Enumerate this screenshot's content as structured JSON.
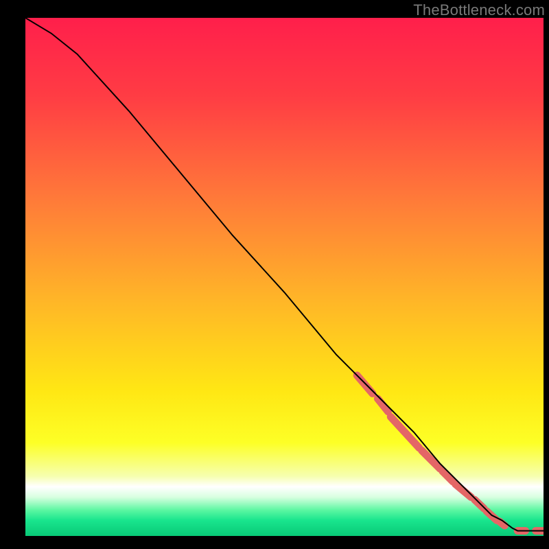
{
  "watermark": "TheBottleneck.com",
  "colors": {
    "black": "#000000",
    "watermark": "#797979",
    "curve": "#000000",
    "marker": "#e46666",
    "gradient_stops": [
      {
        "offset": 0.0,
        "color": "#ff1f4b"
      },
      {
        "offset": 0.15,
        "color": "#ff3c44"
      },
      {
        "offset": 0.35,
        "color": "#ff7a39"
      },
      {
        "offset": 0.55,
        "color": "#ffb727"
      },
      {
        "offset": 0.72,
        "color": "#ffe714"
      },
      {
        "offset": 0.82,
        "color": "#fdff26"
      },
      {
        "offset": 0.885,
        "color": "#f6ffb0"
      },
      {
        "offset": 0.905,
        "color": "#ffffff"
      },
      {
        "offset": 0.925,
        "color": "#d8ffe0"
      },
      {
        "offset": 0.95,
        "color": "#5cf7a2"
      },
      {
        "offset": 0.97,
        "color": "#19e58d"
      },
      {
        "offset": 1.0,
        "color": "#08c977"
      }
    ]
  },
  "chart_data": {
    "type": "line",
    "title": "",
    "xlabel": "",
    "ylabel": "",
    "xlim": [
      0,
      100
    ],
    "ylim": [
      0,
      100
    ],
    "series": [
      {
        "name": "bottleneck-curve",
        "x": [
          0,
          5,
          10,
          20,
          30,
          40,
          50,
          60,
          65,
          70,
          75,
          80,
          83,
          86,
          88,
          90,
          92,
          94,
          95,
          97,
          100
        ],
        "y": [
          100,
          97,
          93,
          82,
          70,
          58,
          47,
          35,
          30,
          25,
          20,
          14,
          11,
          8,
          6,
          4,
          3,
          1.5,
          1,
          1,
          1
        ]
      }
    ],
    "markers": {
      "name": "highlighted-segments",
      "segments": [
        {
          "x0": 64,
          "y0": 31,
          "x1": 67,
          "y1": 27.5
        },
        {
          "x0": 68,
          "y0": 26.5,
          "x1": 70,
          "y1": 24
        },
        {
          "x0": 70.5,
          "y0": 23,
          "x1": 76,
          "y1": 17
        },
        {
          "x0": 76.5,
          "y0": 16.5,
          "x1": 80,
          "y1": 13
        },
        {
          "x0": 80.5,
          "y0": 12.5,
          "x1": 82.5,
          "y1": 10.5
        },
        {
          "x0": 83,
          "y0": 10,
          "x1": 86,
          "y1": 7.5
        },
        {
          "x0": 86.7,
          "y0": 7,
          "x1": 88.5,
          "y1": 5.3
        },
        {
          "x0": 89,
          "y0": 4.8,
          "x1": 91,
          "y1": 3
        },
        {
          "x0": 91.5,
          "y0": 2.8,
          "x1": 92.5,
          "y1": 2
        },
        {
          "x0": 95,
          "y0": 1,
          "x1": 96.5,
          "y1": 1
        },
        {
          "x0": 98.5,
          "y0": 1,
          "x1": 100,
          "y1": 1
        }
      ]
    }
  }
}
